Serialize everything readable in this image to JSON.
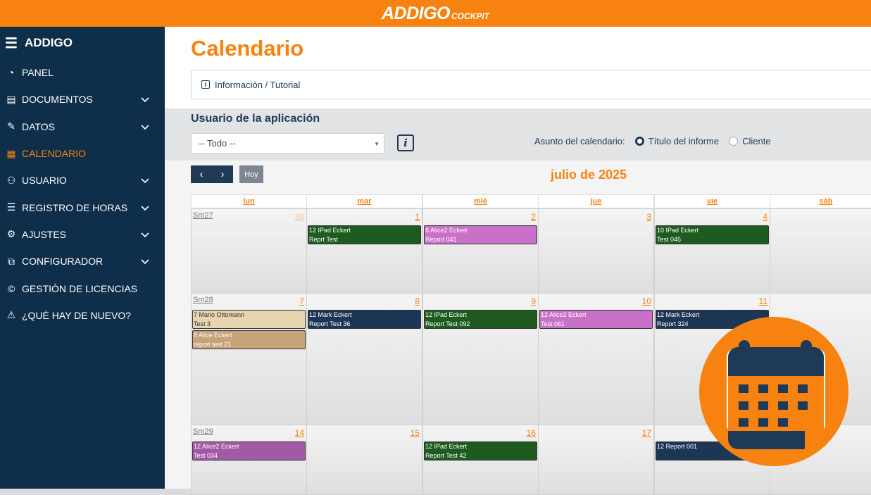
{
  "brand": {
    "name": "ADDIGO",
    "sub": "COCKPIT"
  },
  "sidebar": {
    "title": "ADDIGO",
    "items": [
      {
        "label": "PANEL",
        "icon": "gauge-icon",
        "chevron": false,
        "active": false
      },
      {
        "label": "DOCUMENTOS",
        "icon": "document-icon",
        "chevron": true,
        "active": false
      },
      {
        "label": "DATOS",
        "icon": "edit-data-icon",
        "chevron": true,
        "active": false
      },
      {
        "label": "CALENDARIO",
        "icon": "calendar-icon",
        "chevron": false,
        "active": true
      },
      {
        "label": "USUARIO",
        "icon": "users-icon",
        "chevron": true,
        "active": false
      },
      {
        "label": "REGISTRO DE HORAS",
        "icon": "list-icon",
        "chevron": true,
        "active": false
      },
      {
        "label": "AJUSTES",
        "icon": "gear-icon",
        "chevron": true,
        "active": false
      },
      {
        "label": "CONFIGURADOR",
        "icon": "sitemap-icon",
        "chevron": true,
        "active": false
      },
      {
        "label": "GESTIÓN DE LICENCIAS",
        "icon": "copyright-icon",
        "chevron": false,
        "active": false
      },
      {
        "label": "¿QUÉ HAY DE NUEVO?",
        "icon": "warning-icon",
        "chevron": false,
        "active": false
      }
    ]
  },
  "page": {
    "title": "Calendario",
    "info_link": "Información / Tutorial"
  },
  "filters": {
    "user_label": "Usuario de la aplicación",
    "user_select": "-- Todo --",
    "info_button": "i",
    "subject_label": "Asunto del calendario:",
    "subject_options": [
      {
        "label": "Título del informe",
        "selected": true
      },
      {
        "label": "Cliente",
        "selected": false
      }
    ]
  },
  "calendar": {
    "today_button": "Hoy",
    "month": "julio de 2025",
    "days": [
      "lun",
      "mar",
      "mié",
      "jue",
      "vie",
      "sáb"
    ],
    "weeks": [
      {
        "label": "Sm27",
        "dates": [
          "30",
          "1",
          "2",
          "3",
          "4",
          ""
        ]
      },
      {
        "label": "Sm28",
        "dates": [
          "7",
          "8",
          "9",
          "10",
          "11",
          ""
        ]
      },
      {
        "label": "Sm29",
        "dates": [
          "14",
          "15",
          "16",
          "17",
          "",
          ""
        ]
      }
    ],
    "events": [
      {
        "week": 0,
        "day": 1,
        "slot": 0,
        "line1": "12 IPad Eckert",
        "line2": "Reprt Test",
        "color": "#1d5b1f"
      },
      {
        "week": 0,
        "day": 2,
        "slot": 0,
        "line1": "8 Alice2 Eckert",
        "line2": "Report 041",
        "color": "#c971c9"
      },
      {
        "week": 0,
        "day": 4,
        "slot": 0,
        "line1": "10 IPad Eckert",
        "line2": "Test 045",
        "color": "#1d5b1f"
      },
      {
        "week": 1,
        "day": 0,
        "slot": 0,
        "line1": "7 Mario Ottomann",
        "line2": "Test 3",
        "color": "#e6d5af",
        "dark": true
      },
      {
        "week": 1,
        "day": 0,
        "slot": 1,
        "line1": "8 Alice Eckert",
        "line2": "report test 21",
        "color": "#c6a379"
      },
      {
        "week": 1,
        "day": 1,
        "slot": 0,
        "line1": "12 Mark Eckert",
        "line2": "Report Test 36",
        "color": "#1e3656"
      },
      {
        "week": 1,
        "day": 2,
        "slot": 0,
        "line1": "12 IPad Eckert",
        "line2": "Report Test 092",
        "color": "#1d5b1f"
      },
      {
        "week": 1,
        "day": 3,
        "slot": 0,
        "line1": "12 Alice2 Eckert",
        "line2": "Test 061",
        "color": "#c971c9"
      },
      {
        "week": 1,
        "day": 4,
        "slot": 0,
        "line1": "12 Mark Eckert",
        "line2": "Report 324",
        "color": "#1e3656"
      },
      {
        "week": 2,
        "day": 0,
        "slot": 0,
        "line1": "12 Alice2 Eckert",
        "line2": "Test 034",
        "color": "#a35aa6"
      },
      {
        "week": 2,
        "day": 2,
        "slot": 0,
        "line1": "12 IPad Eckert",
        "line2": "Report Test 42",
        "color": "#1d5b1f"
      },
      {
        "week": 2,
        "day": 4,
        "slot": 0,
        "line1": "12 Report 001",
        "line2": "",
        "color": "#1e3656"
      }
    ]
  },
  "colors": {
    "accent": "#f7820f",
    "navy": "#0f2e4a"
  }
}
